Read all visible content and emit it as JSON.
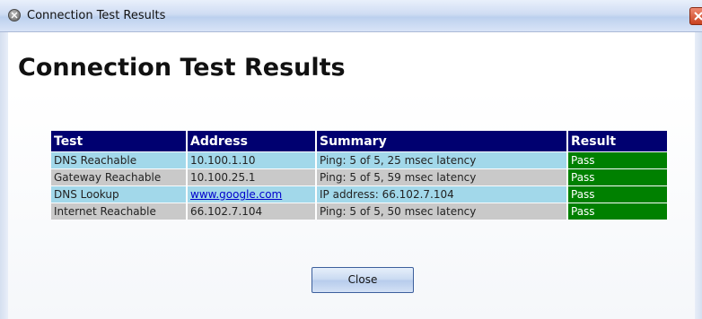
{
  "window": {
    "title": "Connection Test Results",
    "icon": "app-icon",
    "close_icon": "close-icon"
  },
  "heading": "Connection Test Results",
  "table": {
    "headers": [
      "Test",
      "Address",
      "Summary",
      "Result"
    ],
    "rows": [
      {
        "test": "DNS Reachable",
        "address": "10.100.1.10",
        "summary": "Ping: 5 of 5, 25 msec latency",
        "result": "Pass"
      },
      {
        "test": "Gateway Reachable",
        "address": "10.100.25.1",
        "summary": "Ping: 5 of 5, 59 msec latency",
        "result": "Pass"
      },
      {
        "test": "DNS Lookup",
        "address": "www.google.com",
        "summary": "IP address: 66.102.7.104",
        "result": "Pass"
      },
      {
        "test": "Internet Reachable",
        "address": "66.102.7.104",
        "summary": "Ping: 5 of 5, 50 msec latency",
        "result": "Pass"
      }
    ]
  },
  "close_button": "Close",
  "colors": {
    "header_bg": "#000070",
    "row_odd_bg": "#a2d8ea",
    "row_even_bg": "#c9c9c9",
    "pass_bg": "#008000"
  }
}
